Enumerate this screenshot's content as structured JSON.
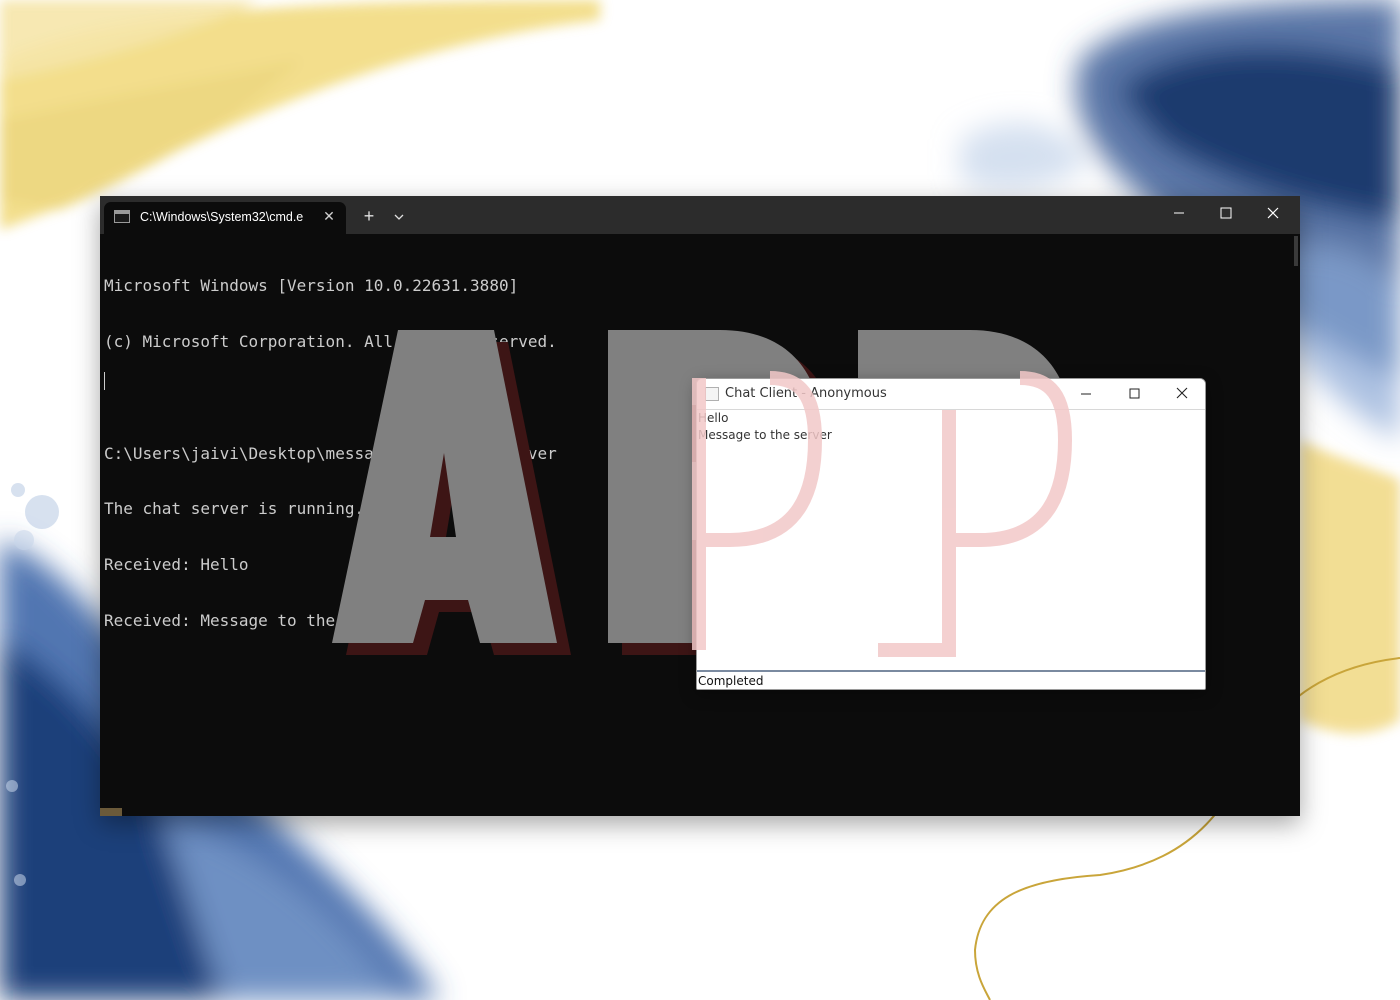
{
  "terminal": {
    "tab_title": "C:\\Windows\\System32\\cmd.e",
    "lines": [
      "Microsoft Windows [Version 10.0.22631.3880]",
      "(c) Microsoft Corporation. All rights reserved.",
      "",
      "C:\\Users\\jaivi\\Desktop\\messages>java ChatServer",
      "The chat server is running...",
      "Received: Hello",
      "Received: Message to the server"
    ],
    "icons": {
      "tab": "terminal-icon",
      "tab_close": "close-icon",
      "new_tab": "plus-icon",
      "dropdown": "chevron-down-icon",
      "minimize": "minimize-icon",
      "maximize": "maximize-icon",
      "close": "close-icon"
    }
  },
  "watermark": {
    "text": "APP"
  },
  "chat_client": {
    "title": "Chat Client - Anonymous",
    "messages": [
      "Hello",
      "Message to the server"
    ],
    "input_value": "Completed",
    "icons": {
      "app": "java-icon",
      "minimize": "minimize-icon",
      "maximize": "maximize-icon",
      "close": "close-icon"
    }
  },
  "colors": {
    "terminal_bg": "#0c0c0c",
    "terminal_titlebar": "#2c2c2c",
    "terminal_text": "#cccccc",
    "watermark_gray": "#808080",
    "watermark_shadow": "#3d1515",
    "watermark_pink": "#f2c8c8",
    "accent_gold": "#c9a53a",
    "accent_navy": "#1e3a6e"
  }
}
